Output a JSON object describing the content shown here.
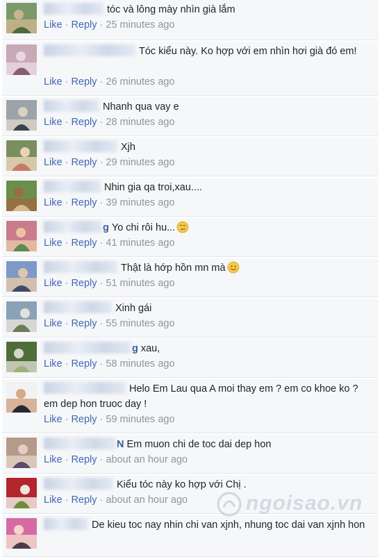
{
  "actions": {
    "like": "Like",
    "reply": "Reply",
    "separator": "·"
  },
  "comments": [
    {
      "name_tail": "",
      "text": "tóc và lông mày nhìn già lắm",
      "time": "25 minutes ago"
    },
    {
      "name_tail": "",
      "text": "Tóc kiểu này. Ko hợp với em nhìn hơi già đó em!",
      "time": "26 minutes ago"
    },
    {
      "name_tail": "",
      "text": "Nhanh qua vay e",
      "time": "28 minutes ago"
    },
    {
      "name_tail": "",
      "text": "Xjh",
      "time": "29 minutes ago"
    },
    {
      "name_tail": "",
      "text": "Nhin gia qa troi,xau....",
      "time": "39 minutes ago"
    },
    {
      "name_tail": "g",
      "text": "Yo chi rôi hu...",
      "time": "41 minutes ago",
      "emoji": "crying-face"
    },
    {
      "name_tail": "",
      "text": "Thật là hớp hồn mn mà",
      "time": "51 minutes ago",
      "emoji": "smiling-face"
    },
    {
      "name_tail": "",
      "text": "Xinh gái",
      "time": "55 minutes ago"
    },
    {
      "name_tail": "g",
      "text": "xau,",
      "time": "58 minutes ago"
    },
    {
      "name_tail": "",
      "text": "Helo Em Lau qua A moi thay em ? em co khoe ko ? em dep hon truoc day !",
      "time": "59 minutes ago"
    },
    {
      "name_tail": "N",
      "text": "Em muon chi de toc dai dep hon",
      "time": "about an hour ago"
    },
    {
      "name_tail": "",
      "text": "Kiểu tóc này ko hợp với Chị .",
      "time": "about an hour ago"
    },
    {
      "name_tail": "",
      "text": "De kieu toc nay nhin chi van xjnh, nhung toc dai van xjnh hon",
      "time": ""
    }
  ],
  "watermark": "ngoisao.vn",
  "colors": {
    "link": "#4267b2",
    "meta": "#90949c",
    "row_bg": "#f6f7f9",
    "text": "#1d2129"
  }
}
